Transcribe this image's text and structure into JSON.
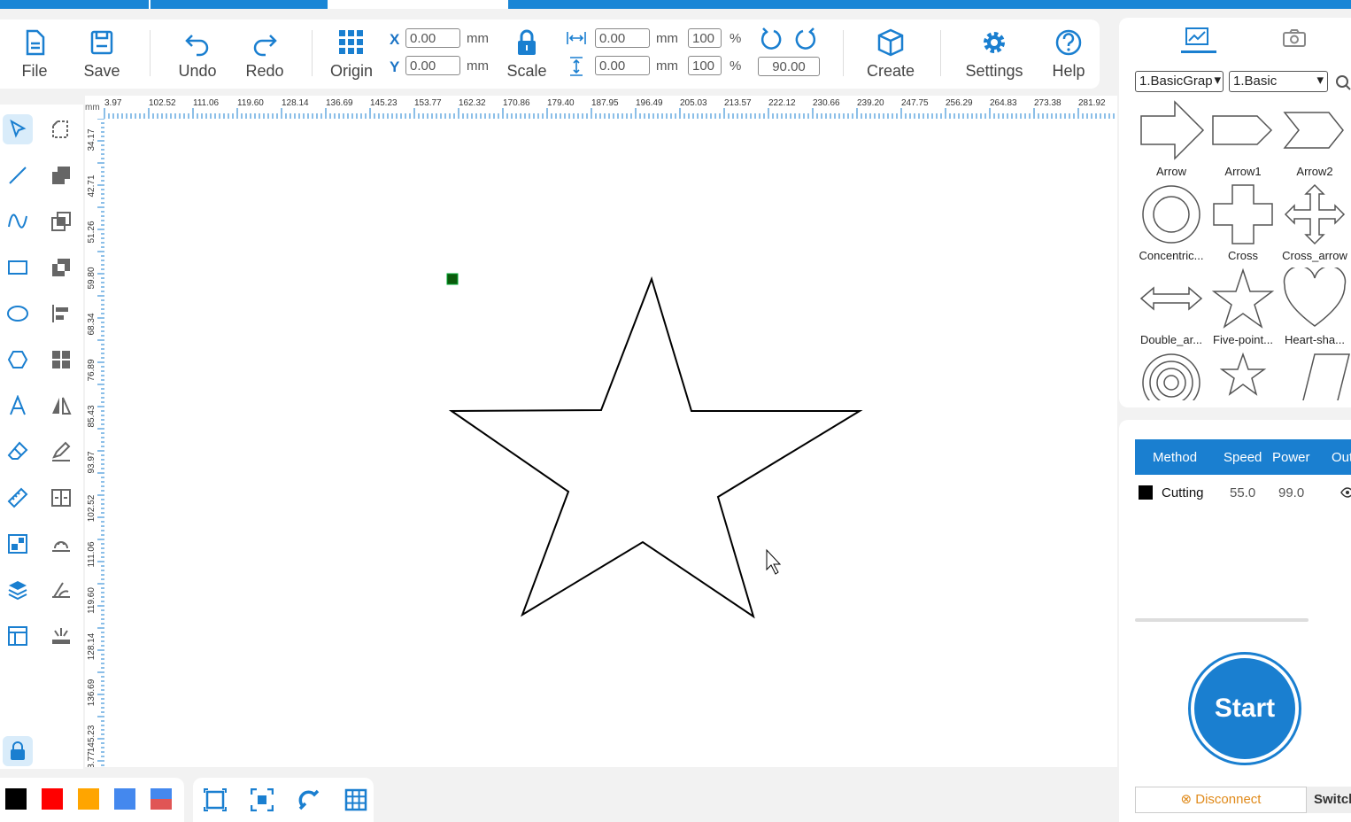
{
  "toolbar": {
    "file": "File",
    "save": "Save",
    "undo": "Undo",
    "redo": "Redo",
    "origin": "Origin",
    "scale": "Scale",
    "create": "Create",
    "settings": "Settings",
    "help": "Help",
    "x_label": "X",
    "y_label": "Y",
    "x_value": "0.00",
    "y_value": "0.00",
    "width_value": "0.00",
    "height_value": "0.00",
    "width_pct": "100",
    "height_pct": "100",
    "rotate_value": "90.00",
    "unit_mm": "mm",
    "unit_pct": "%"
  },
  "ruler": {
    "unit": "mm",
    "top_ticks": [
      "3.97",
      "102.52",
      "111.06",
      "119.60",
      "128.14",
      "136.69",
      "145.23",
      "153.77",
      "162.32",
      "170.86",
      "179.40",
      "187.95",
      "196.49",
      "205.03",
      "213.57",
      "222.12",
      "230.66",
      "239.20",
      "247.75",
      "256.29",
      "264.83",
      "273.38",
      "281.92"
    ],
    "left_ticks": [
      "34.17",
      "42.71",
      "51.26",
      "59.80",
      "68.34",
      "76.89",
      "85.43",
      "93.97",
      "102.52",
      "111.06",
      "119.60",
      "128.14",
      "136.69",
      "145.23",
      "3.77"
    ]
  },
  "library": {
    "category_select": "1.BasicGrap",
    "subcategory_select": "1.Basic",
    "shapes": [
      "Arrow",
      "Arrow1",
      "Arrow2",
      "Concentric...",
      "Cross",
      "Cross_arrow",
      "Double_ar...",
      "Five-point...",
      "Heart-sha..."
    ]
  },
  "layers": {
    "headers": [
      "Method",
      "Speed",
      "Power",
      "Out"
    ],
    "rows": [
      {
        "color": "#000000",
        "method": "Cutting",
        "speed": "55.0",
        "power": "99.0"
      }
    ]
  },
  "actions": {
    "start": "Start",
    "disconnect": "Disconnect",
    "switch": "Switch"
  },
  "colors": {
    "accent": "#1a7fd0",
    "swatches": [
      "#000000",
      "#ff0000",
      "#ffa500",
      "#4488ee"
    ]
  },
  "icons": {
    "tools_left": [
      "select-arrow-icon",
      "line-icon",
      "curve-icon",
      "rectangle-icon",
      "ellipse-icon",
      "polygon-icon",
      "text-icon",
      "eraser-icon",
      "ruler-icon",
      "array-icon",
      "layers-icon",
      "layout-icon",
      "lock-icon"
    ],
    "tools_right": [
      "node-edit-icon",
      "union-icon",
      "intersect-icon",
      "difference-icon",
      "align-left-icon",
      "grid-icon",
      "mirror-icon",
      "edit-path-icon",
      "split-icon",
      "offset-icon",
      "bevel-icon",
      "laser-icon"
    ]
  }
}
